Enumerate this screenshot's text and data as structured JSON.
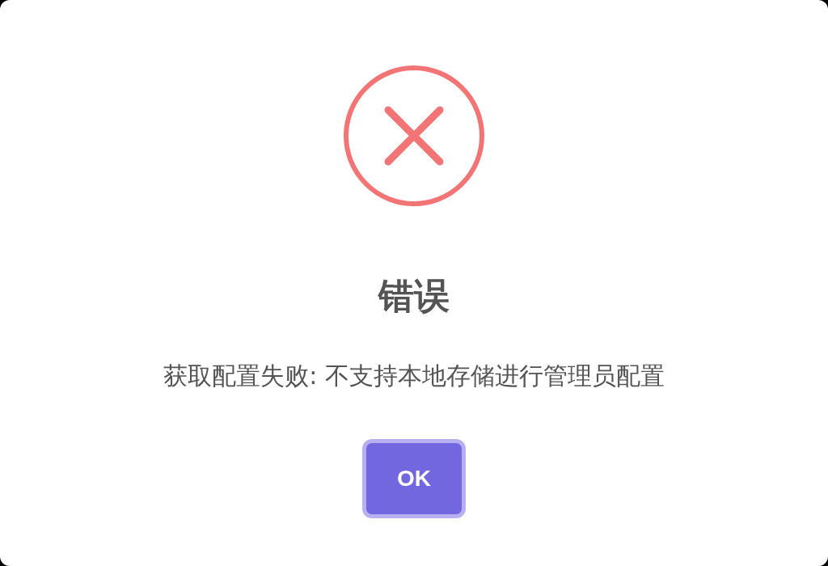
{
  "dialog": {
    "title": "错误",
    "message": "获取配置失败: 不支持本地存储进行管理员配置",
    "buttons": [
      {
        "label": "OK",
        "focused": true
      }
    ]
  }
}
